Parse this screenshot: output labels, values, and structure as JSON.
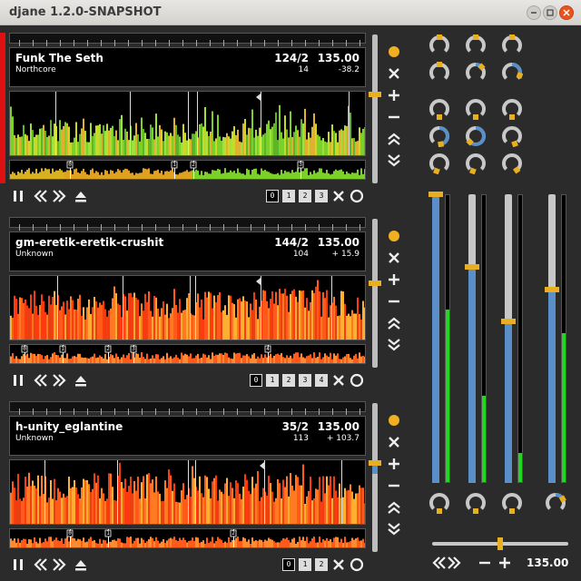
{
  "window": {
    "title": "djane 1.2.0-SNAPSHOT"
  },
  "decks": [
    {
      "title": "Funk The Seth",
      "artist": "Northcore",
      "bars": "124/2",
      "bpm": "135.00",
      "beats": "14",
      "offset": "-38.2",
      "cues": [
        "0",
        "1",
        "2",
        "3"
      ],
      "active_cue": 0,
      "active": true,
      "wave_palette": "green",
      "pitch": 0.4
    },
    {
      "title": "gm-eretik-eretik-crushit",
      "artist": "Unknown",
      "bars": "144/2",
      "bpm": "135.00",
      "beats": "104",
      "offset": "+ 15.9",
      "cues": [
        "0",
        "1",
        "2",
        "3",
        "4"
      ],
      "active_cue": 0,
      "active": false,
      "wave_palette": "fire",
      "pitch": 0.43
    },
    {
      "title": "h-unity_eglantine",
      "artist": "Unknown",
      "bars": "35/2",
      "bpm": "135.00",
      "beats": "113",
      "offset": "+ 103.7",
      "cues": [
        "0",
        "1",
        "2"
      ],
      "active_cue": 0,
      "active": false,
      "wave_palette": "fire",
      "pitch": 0.4
    }
  ],
  "mixer": {
    "faders": [
      {
        "level": 1.0,
        "vu": 0.6
      },
      {
        "level": 0.75,
        "vu": 0.3
      },
      {
        "level": 0.56,
        "vu": 0.1
      },
      {
        "level": 0.67,
        "vu": 0.52
      }
    ],
    "master_bpm": "135.00"
  },
  "colors": {
    "accent": "#e8b020",
    "knob_blue": "#5b8fc8",
    "deck_active": "#dd1111",
    "vu_green": "#22d622"
  }
}
